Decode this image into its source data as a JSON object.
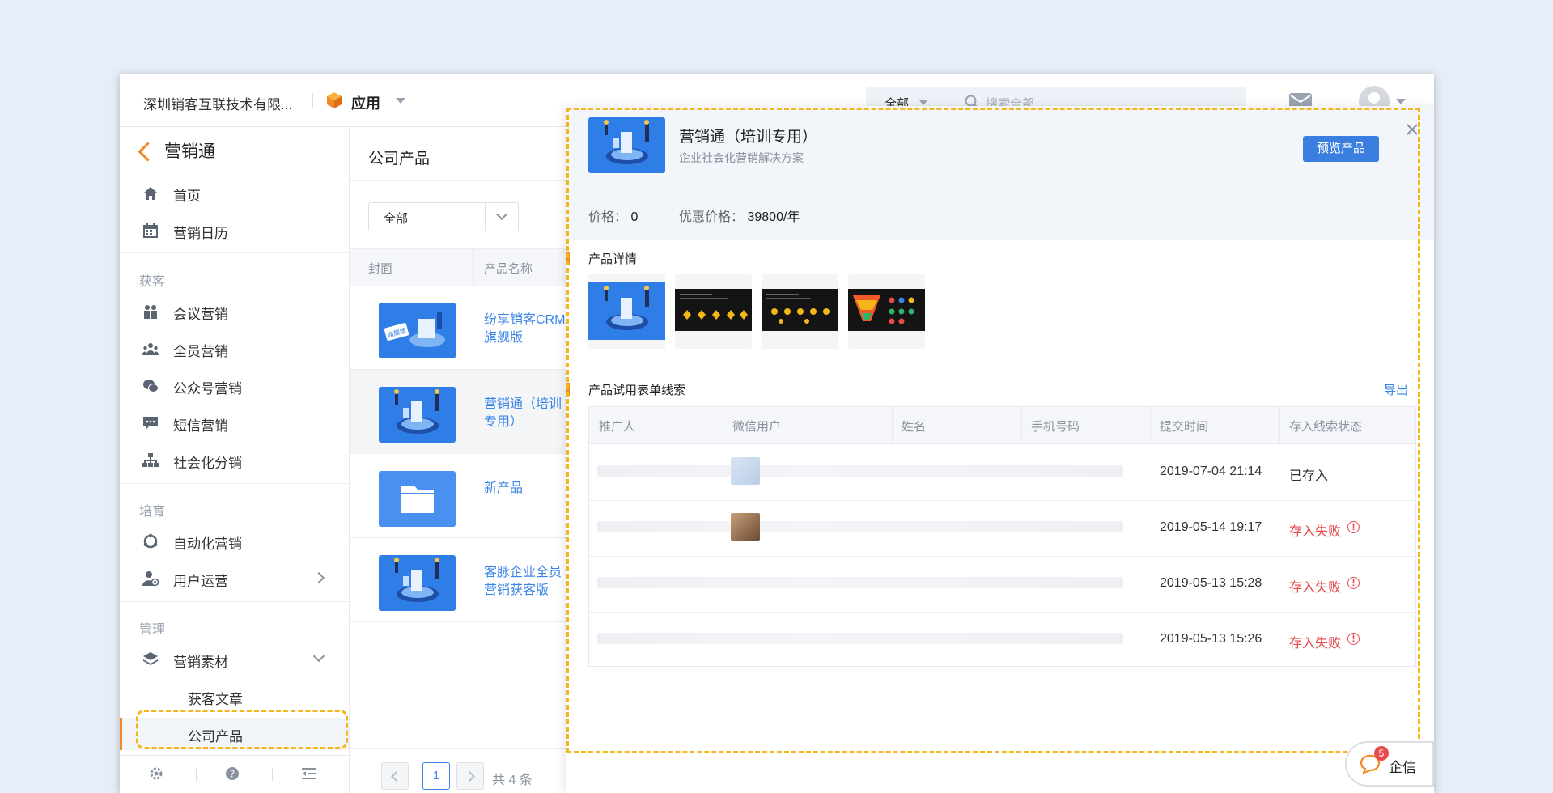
{
  "header": {
    "company": "深圳销客互联技术有限...",
    "app_label": "应用",
    "search_scope": "全部",
    "search_placeholder": "搜索全部"
  },
  "sidebar": {
    "title": "营销通",
    "items_top": [
      {
        "label": "首页",
        "icon": "home-icon"
      },
      {
        "label": "营销日历",
        "icon": "calendar-icon"
      }
    ],
    "section_acquire": "获客",
    "items_acquire": [
      {
        "label": "会议营销",
        "icon": "meeting-icon"
      },
      {
        "label": "全员营销",
        "icon": "people-icon"
      },
      {
        "label": "公众号营销",
        "icon": "wechat-icon"
      },
      {
        "label": "短信营销",
        "icon": "sms-icon"
      },
      {
        "label": "社会化分销",
        "icon": "hierarchy-icon"
      }
    ],
    "section_nurture": "培育",
    "items_nurture": [
      {
        "label": "自动化营销",
        "icon": "automation-icon"
      },
      {
        "label": "用户运营",
        "icon": "user-ops-icon"
      }
    ],
    "section_manage": "管理",
    "materials_label": "营销素材",
    "sub_items": [
      "获客文章",
      "公司产品"
    ]
  },
  "product_list": {
    "title": "公司产品",
    "filter_value": "全部",
    "col_cover": "封面",
    "col_name": "产品名称",
    "products": [
      {
        "name": "纷享销客CRM旗舰版",
        "thumb": "flagship"
      },
      {
        "name": "营销通（培训专用）",
        "thumb": "marketing"
      },
      {
        "name": "新产品",
        "thumb": "folder"
      },
      {
        "name": "客脉企业全员营销获客版",
        "thumb": "marketing"
      }
    ],
    "page": "1",
    "total": "共 4 条"
  },
  "detail": {
    "name": "营销通（培训专用）",
    "subtitle": "企业社会化营销解决方案",
    "preview_label": "预览产品",
    "price_label": "价格：",
    "price_value": "0",
    "discount_label": "优惠价格：",
    "discount_value": "39800/年",
    "section_detail": "产品详情",
    "section_leads": "产品试用表单线索",
    "export_label": "导出",
    "columns": [
      "推广人",
      "微信用户",
      "姓名",
      "手机号码",
      "提交时间",
      "存入线索状态"
    ],
    "rows": [
      {
        "time": "2019-07-04 21:14",
        "status": "已存入",
        "failed": false
      },
      {
        "time": "2019-05-14 19:17",
        "status": "存入失败",
        "failed": true
      },
      {
        "time": "2019-05-13 15:28",
        "status": "存入失败",
        "failed": true
      },
      {
        "time": "2019-05-13 15:26",
        "status": "存入失败",
        "failed": true
      }
    ]
  },
  "qixin": {
    "label": "企信",
    "badge": "5"
  },
  "colors": {
    "accent": "#f08a24",
    "link": "#3a86e8",
    "primary_button": "#3a7fe0",
    "error": "#e8494b",
    "highlight": "#f5b61a"
  }
}
